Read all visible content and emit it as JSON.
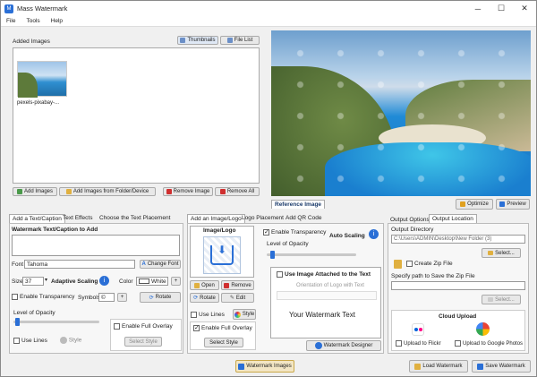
{
  "window": {
    "title": "Mass Watermark"
  },
  "menu": [
    "File",
    "Tools",
    "Help"
  ],
  "images_panel": {
    "label": "Added Images",
    "view_thumbnails": "Thumbnails",
    "view_list": "File List",
    "thumb_caption": "pexels-pixabay-...",
    "btn_add": "Add Images",
    "btn_add_folder": "Add Images from Folder/Device",
    "btn_remove": "Remove Image",
    "btn_remove_all": "Remove All"
  },
  "reference": {
    "tab_label": "Reference Image",
    "btn_optimize": "Optimize",
    "btn_preview": "Preview"
  },
  "text_tab": {
    "tabs": [
      "Add a Text/Caption",
      "Text Effects",
      "Choose the Text Placement"
    ],
    "caption_label": "Watermark Text/Caption to Add",
    "font_label": "Font",
    "font_value": "Tahoma",
    "btn_change_font": "Change Font",
    "size_label": "Size",
    "size_value": "37",
    "adaptive_label": "Adaptive Scaling",
    "color_label": "Color",
    "color_value": "White",
    "transparency_label": "Enable Transparency",
    "symbols_label": "Symbols",
    "symbols_value": "©",
    "btn_rotate": "Rotate",
    "opacity_label": "Level of Opacity",
    "use_lines": "Use Lines",
    "style": "Style",
    "full_overlay": "Enable Full Overlay",
    "select_style": "Select Style"
  },
  "logo_tab": {
    "tabs": [
      "Add an Image/Logo",
      "Logo Placement",
      "Add QR Code"
    ],
    "image_label": "Image/Logo",
    "btn_open": "Open",
    "btn_remove": "Remove",
    "btn_rotate": "Rotate",
    "btn_edit": "Edit",
    "use_lines": "Use Lines",
    "style": "Style",
    "full_overlay": "Enable Full Overlay",
    "select_style": "Select Style",
    "transparency": "Enable Transparency",
    "auto_scaling": "Auto Scaling",
    "opacity_label": "Level of Opacity",
    "use_attached": "Use Image Attached to the Text",
    "orientation": "Orientation of Logo with Text",
    "sample_text": "Your Watermark Text",
    "btn_designer": "Watermark Designer"
  },
  "output_tab": {
    "tabs": [
      "Output Options",
      "Output Location"
    ],
    "dir_label": "Output Directory",
    "dir_value": "C:\\Users\\ADMIN\\Desktop\\New Folder (3)",
    "btn_select": "Select...",
    "zip_label": "Create Zip File",
    "zip_path_label": "Specify path to Save the Zip File",
    "btn_select2": "Select...",
    "cloud_label": "Cloud Upload",
    "flickr": "Upload to Flickr",
    "gphotos": "Upload to Google Photos"
  },
  "footer": {
    "btn_watermark": "Watermark Images",
    "btn_load": "Load Watermark",
    "btn_save": "Save Watermark"
  },
  "colors": {
    "accent": "#2a6fd6",
    "panel": "#f7f7f7"
  }
}
